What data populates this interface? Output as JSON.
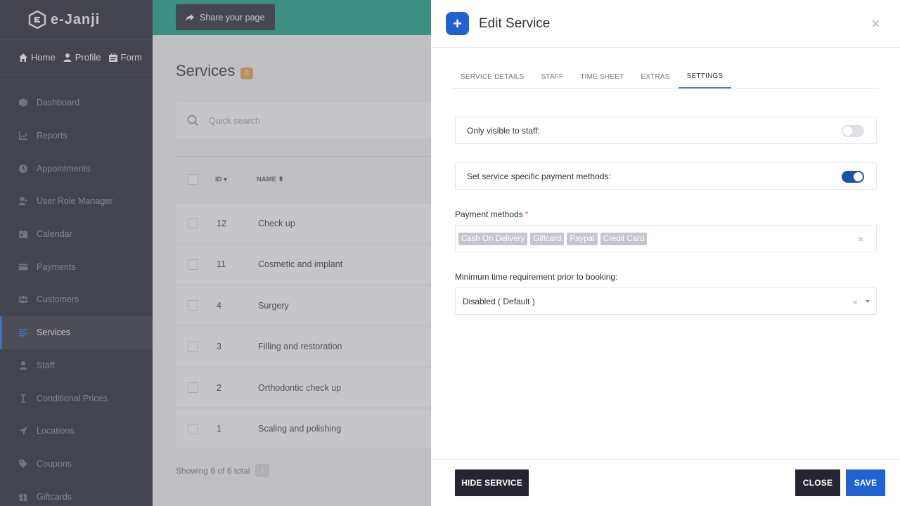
{
  "brand": {
    "name": "e-Janji"
  },
  "topnav": [
    {
      "label": "Home",
      "icon": "home-icon"
    },
    {
      "label": "Profile",
      "icon": "user-icon"
    },
    {
      "label": "Form",
      "icon": "form-icon"
    }
  ],
  "sidebar": {
    "items": [
      {
        "label": "Dashboard",
        "icon": "cube-icon"
      },
      {
        "label": "Reports",
        "icon": "chart-icon"
      },
      {
        "label": "Appointments",
        "icon": "clock-icon"
      },
      {
        "label": "User Role Manager",
        "icon": "user-plus-icon"
      },
      {
        "label": "Calendar",
        "icon": "calendar-icon"
      },
      {
        "label": "Payments",
        "icon": "credit-card-icon"
      },
      {
        "label": "Customers",
        "icon": "users-icon"
      },
      {
        "label": "Services",
        "icon": "list-icon",
        "active": true
      },
      {
        "label": "Staff",
        "icon": "user-icon"
      },
      {
        "label": "Conditional Prices",
        "icon": "cursor-icon"
      },
      {
        "label": "Locations",
        "icon": "location-arrow-icon"
      },
      {
        "label": "Coupons",
        "icon": "tag-icon"
      },
      {
        "label": "Giftcards",
        "icon": "gift-icon"
      }
    ]
  },
  "main": {
    "share_label": "Share your page",
    "title": "Services",
    "count": "6",
    "search_placeholder": "Quick search",
    "columns": {
      "id": "ID",
      "name": "NAME"
    },
    "rows": [
      {
        "id": "12",
        "name": "Check up"
      },
      {
        "id": "11",
        "name": "Cosmetic and implant"
      },
      {
        "id": "4",
        "name": "Surgery"
      },
      {
        "id": "3",
        "name": "Filling and restoration"
      },
      {
        "id": "2",
        "name": "Orthodontic check up"
      },
      {
        "id": "1",
        "name": "Scaling and polishing"
      }
    ],
    "footer_text": "Showing 6 of 6 total",
    "page": "1"
  },
  "panel": {
    "title": "Edit Service",
    "close_icon": "×",
    "tabs": [
      {
        "label": "SERVICE DETAILS"
      },
      {
        "label": "STAFF"
      },
      {
        "label": "TIME SHEET"
      },
      {
        "label": "EXTRAS"
      },
      {
        "label": "SETTINGS",
        "active": true
      }
    ],
    "settings": {
      "only_visible_label": "Only visible to staff:",
      "only_visible_on": false,
      "specific_payment_label": "Set service specific payment methods:",
      "specific_payment_on": true,
      "payment_methods_label": "Payment methods",
      "required_mark": "*",
      "payment_methods": [
        "Cash On Delivery",
        "Giftcard",
        "Paypal",
        "Credit Card"
      ],
      "min_time_label": "Minimum time requirement prior to booking:",
      "min_time_value": "Disabled ( Default )",
      "clear_symbol": "×"
    },
    "footer": {
      "hide_label": "HIDE SERVICE",
      "close_label": "CLOSE",
      "save_label": "SAVE"
    }
  },
  "colors": {
    "accent": "#1f63d3",
    "topbar": "#14a085",
    "sidebar_bg": "#1e1f2b",
    "dark_button": "#242531",
    "badge": "#e9a23a"
  }
}
